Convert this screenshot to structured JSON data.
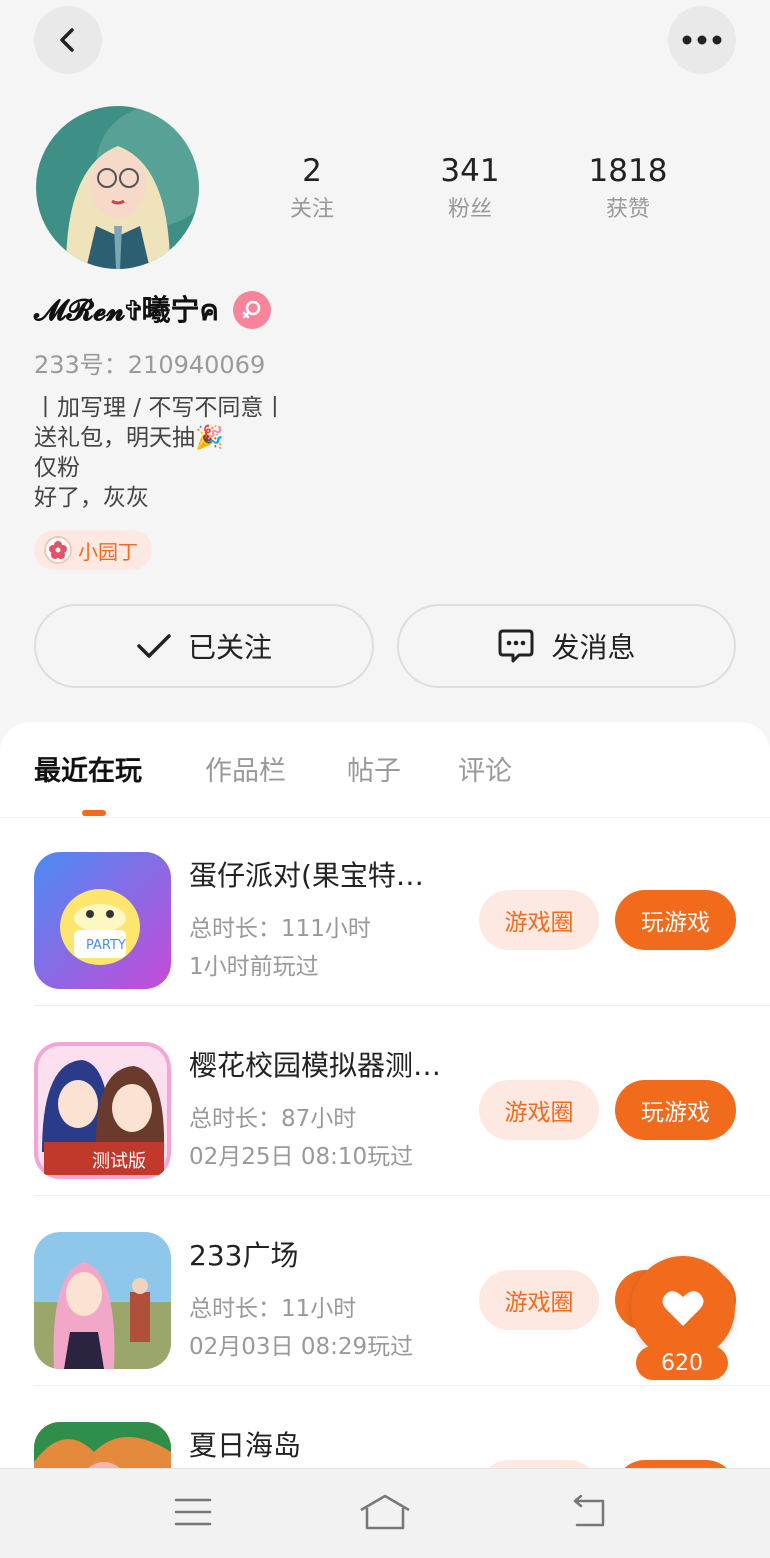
{
  "header": {
    "back_icon": "back-arrow-icon",
    "more_icon": "more-dots-icon"
  },
  "profile": {
    "username": "𝓜𝓡𝓮𝓷✞曦宁ค",
    "gender": "female",
    "user_id": "233号：210940069",
    "bio": [
      "丨加写理 / 不写不同意丨",
      "送礼包，明天抽🎉",
      "仅粉",
      "好了，灰灰"
    ],
    "badge_label": "小园丁",
    "stats": [
      {
        "value": "2",
        "label": "关注"
      },
      {
        "value": "341",
        "label": "粉丝"
      },
      {
        "value": "1818",
        "label": "获赞"
      }
    ]
  },
  "actions": {
    "follow_label": "已关注",
    "message_label": "发消息"
  },
  "tabs": [
    "最近在玩",
    "作品栏",
    "帖子",
    "评论"
  ],
  "games": [
    {
      "title": "蛋仔派对(果宝特…",
      "duration": "总时长：111小时",
      "last_played": "1小时前玩过",
      "circle_label": "游戏圈",
      "play_label": "玩游戏"
    },
    {
      "title": "樱花校园模拟器测…",
      "duration": "总时长：87小时",
      "last_played": "02月25日 08:10玩过",
      "circle_label": "游戏圈",
      "play_label": "玩游戏"
    },
    {
      "title": "233广场",
      "duration": "总时长：11小时",
      "last_played": "02月03日 08:29玩过",
      "circle_label": "游戏圈",
      "play_label": "玩游戏"
    },
    {
      "title": "夏日海岛",
      "duration": "",
      "last_played": "",
      "circle_label": "",
      "play_label": ""
    }
  ],
  "like_float": {
    "count": "620"
  },
  "colors": {
    "accent": "#f26b1d",
    "accent_light": "#fde9e2",
    "female_badge": "#f7849a"
  }
}
